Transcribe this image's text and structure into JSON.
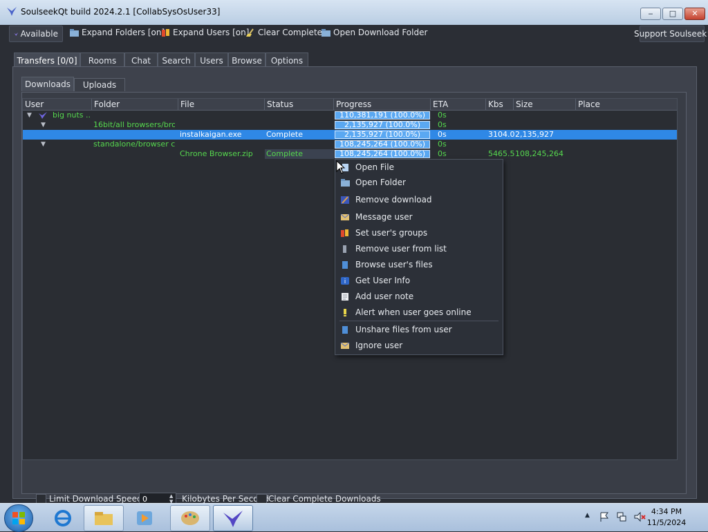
{
  "window": {
    "title": "SoulseekQt build 2024.2.1 [CollabSysOsUser33]",
    "controls": [
      "‒",
      "□",
      "✕"
    ]
  },
  "toolbar": {
    "available": "Available",
    "expand_folders": "Expand Folders [on]",
    "expand_users": "Expand Users [on]",
    "clear_complete": "Clear Complete",
    "open_download_folder": "Open Download Folder",
    "support": "Support Soulseek!"
  },
  "tabs": [
    "Transfers [0/0]",
    "Rooms",
    "Chat",
    "Search",
    "Users",
    "Browse",
    "Options"
  ],
  "subtabs": [
    "Downloads",
    "Uploads"
  ],
  "table": {
    "headers": [
      "User",
      "Folder",
      "File",
      "Status",
      "Progress",
      "ETA",
      "Kbs",
      "Size",
      "Place"
    ],
    "rows": [
      {
        "user": "big nuts ...",
        "folder": "",
        "file": "",
        "status": "",
        "progress": "110,381,191 (100.0%)",
        "eta": "0s",
        "kbs": "",
        "size": "",
        "place": ""
      },
      {
        "user": "",
        "folder": "16bit/all browsers/bro...",
        "file": "",
        "status": "",
        "progress": "2,135,927 (100.0%)",
        "eta": "0s",
        "kbs": "",
        "size": "",
        "place": ""
      },
      {
        "user": "",
        "folder": "",
        "file": "instalkaigan.exe",
        "status": "Complete",
        "progress": "2,135,927 (100.0%)",
        "eta": "0s",
        "kbs": "3104.0",
        "size": "2,135,927",
        "place": ""
      },
      {
        "user": "",
        "folder": "standalone/browser c...",
        "file": "",
        "status": "",
        "progress": "108,245,264 (100.0%)",
        "eta": "0s",
        "kbs": "",
        "size": "",
        "place": ""
      },
      {
        "user": "",
        "folder": "",
        "file": "Chrone Browser.zip",
        "status": "Complete",
        "progress": "108,245,264 (100.0%)",
        "eta": "0s",
        "kbs": "5465.5",
        "size": "108,245,264",
        "place": ""
      }
    ]
  },
  "bottom": {
    "limit_label": "Limit Download Speed to",
    "limit_value": "0",
    "unit_label": "Kilobytes Per Second",
    "clear_label": "Clear Complete Downloads"
  },
  "context_menu": [
    {
      "label": "Open File",
      "icon": "file-icon"
    },
    {
      "label": "Open Folder",
      "icon": "folder-icon"
    },
    {
      "label": "Remove download",
      "icon": "remove-icon"
    },
    {
      "label": "Message user",
      "icon": "message-icon"
    },
    {
      "label": "Set user's groups",
      "icon": "groups-icon"
    },
    {
      "label": "Remove user from list",
      "icon": "list-remove-icon"
    },
    {
      "label": "Browse user's files",
      "icon": "browse-icon"
    },
    {
      "label": "Get User Info",
      "icon": "info-icon"
    },
    {
      "label": "Add user note",
      "icon": "note-icon"
    },
    {
      "label": "Alert when user goes online",
      "icon": "alert-icon"
    },
    {
      "label": "Unshare files from user",
      "icon": "unshare-icon"
    },
    {
      "label": "Ignore user",
      "icon": "ignore-icon"
    }
  ],
  "taskbar": {
    "time": "4:34 PM",
    "date": "11/5/2024"
  },
  "colors": {
    "accent": "#2f88e6",
    "progress": "#5aa8f2",
    "text_green": "#56d84e"
  }
}
